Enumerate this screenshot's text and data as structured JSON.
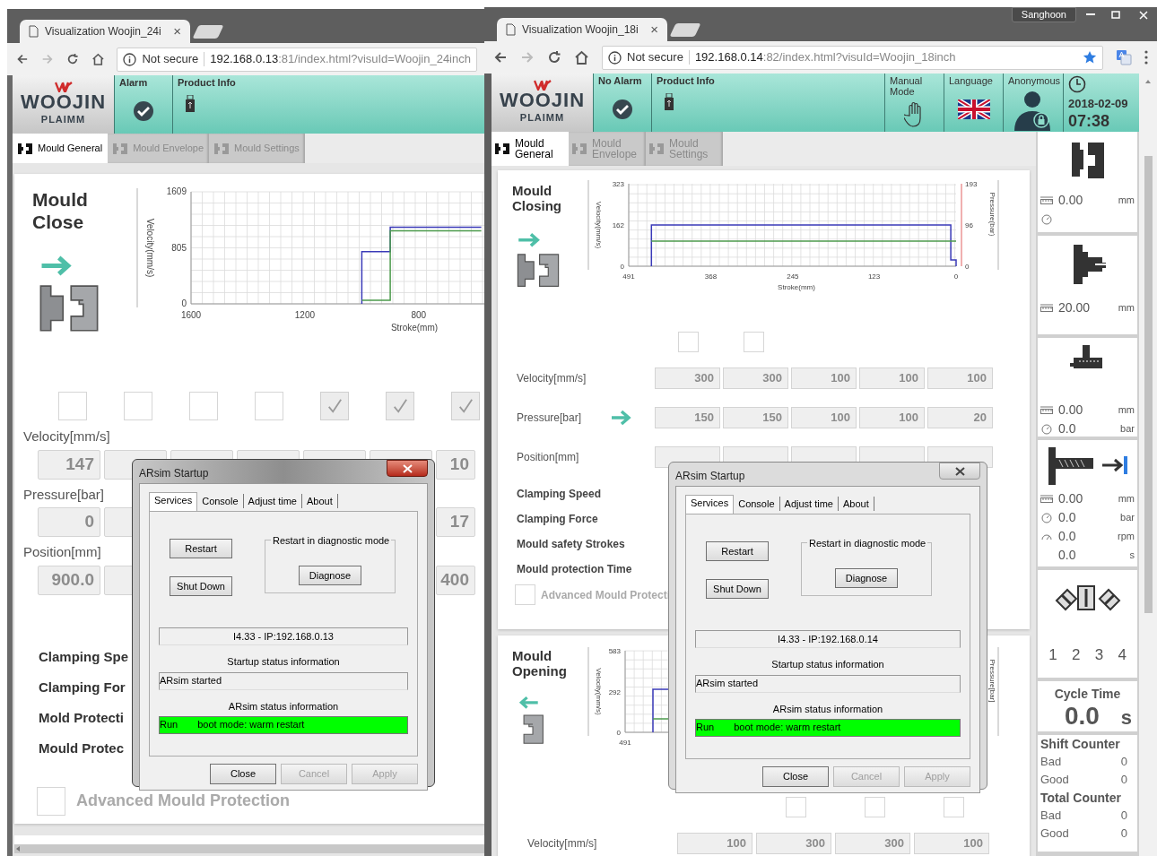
{
  "left_window": {
    "tab": {
      "title": "Visualization Woojin_24i",
      "close": "×"
    },
    "address": {
      "security": "Not secure",
      "host": "192.168.0.13",
      "rest": ":81/index.html?visuId=Woojin_24inch"
    },
    "logo": {
      "name": "WOOJIN",
      "sub": "PLAIMM"
    },
    "header_cells": [
      {
        "kind": "alarm",
        "label": "Alarm"
      },
      {
        "kind": "product",
        "label": "Product Info"
      }
    ],
    "tabs": [
      {
        "label": "Mould General",
        "selected": true
      },
      {
        "label": "Mould Envelope",
        "selected": false
      },
      {
        "label": "Mould Settings",
        "selected": false
      }
    ],
    "section": {
      "title": "Mould Close",
      "chart_data": {
        "type": "line",
        "xlabel": "Stroke(mm)",
        "ylabel": "Velocity(mm/s)",
        "x": [
          1000,
          1000,
          900,
          900,
          580
        ],
        "xlim": [
          1600,
          563
        ],
        "ylim": [
          0,
          1609
        ],
        "xticks": [
          1600,
          1200,
          800
        ],
        "yticks": [
          0,
          805,
          1609
        ],
        "grid": true,
        "series": [
          {
            "color": "#3a3ab8",
            "values": [
              0,
              750,
              750,
              1100,
              1100
            ]
          },
          {
            "color": "#4c9a4c",
            "values": [
              null,
              50,
              50,
              1050,
              1050
            ]
          }
        ]
      },
      "checkboxes": [
        {
          "checked": false
        },
        {
          "checked": false
        },
        {
          "checked": false
        },
        {
          "checked": false
        },
        {
          "checked": true
        },
        {
          "checked": true
        },
        {
          "checked": true
        }
      ],
      "rows": [
        {
          "label": "Velocity[mm/s]",
          "fields": [
            {
              "value": "147"
            },
            {
              "value": "10"
            }
          ]
        },
        {
          "label": "Pressure[bar]",
          "fields": [
            {
              "value": "0"
            },
            {
              "value": "17"
            }
          ]
        },
        {
          "label": "Position[mm]",
          "fields": [
            {
              "value": "900.0"
            },
            {
              "value": "400"
            }
          ]
        }
      ],
      "settings": [
        "Clamping Spe",
        "Clamping For",
        "Mold Protecti",
        "Mould Protec"
      ],
      "advanced": {
        "label": "Advanced Mould Protection",
        "checked": false
      }
    },
    "dialog": {
      "title": "ARsim Startup",
      "active": true,
      "tabs": [
        {
          "label": "Services",
          "selected": true
        },
        {
          "label": "Console",
          "selected": false
        },
        {
          "label": "Adjust time",
          "selected": false
        },
        {
          "label": "About",
          "selected": false
        }
      ],
      "buttons": [
        "Restart",
        "Shut Down"
      ],
      "group": {
        "label": "Restart in diagnostic mode",
        "button": "Diagnose"
      },
      "version": "I4.33 - IP:192.168.0.13",
      "startup_label": "Startup status information",
      "startup_value": "ARsim started",
      "status_label": "ARsim status information",
      "status_state": "Run",
      "status_detail": "boot mode: warm restart",
      "footer_buttons": [
        {
          "label": "Close",
          "disabled": false
        },
        {
          "label": "Cancel",
          "disabled": true
        },
        {
          "label": "Apply",
          "disabled": true
        }
      ]
    }
  },
  "right_window": {
    "profile": "Sanghoon",
    "tab": {
      "title": "Visualization Woojin_18i",
      "close": "×"
    },
    "address": {
      "security": "Not secure",
      "host": "192.168.0.14",
      "rest": ":82/index.html?visuId=Woojin_18inch"
    },
    "logo": {
      "name": "WOOJIN",
      "sub": "PLAIMM"
    },
    "header_cells": [
      {
        "kind": "alarm",
        "label": "No Alarm"
      },
      {
        "kind": "product",
        "label": "Product Info"
      },
      {
        "kind": "manual",
        "label": "Manual Mode"
      },
      {
        "kind": "language",
        "label": "Language"
      },
      {
        "kind": "user",
        "label": "Anonymous"
      },
      {
        "kind": "clock",
        "date": "2018-02-09",
        "time": "07:38"
      }
    ],
    "tabs": [
      {
        "label": "Mould General",
        "selected": true
      },
      {
        "label": "Mould Envelope",
        "selected": false
      },
      {
        "label": "Mould Settings",
        "selected": false
      }
    ],
    "closing": {
      "title": "Mould Closing",
      "chart_data": {
        "type": "line",
        "xlabel": "Stroke(mm)",
        "ylabel": "Velocity(mm/s)",
        "x": [
          457,
          457,
          8,
          8,
          0,
          0
        ],
        "xlim": [
          491,
          0
        ],
        "ylim": [
          0,
          323
        ],
        "xticks": [
          491,
          368,
          245,
          123,
          0
        ],
        "yticks": [
          0,
          162,
          323
        ],
        "grid": true,
        "series": [
          {
            "color": "#3a3ab8",
            "values": [
              0,
              162,
              162,
              25,
              25,
              0
            ]
          },
          {
            "color": "#4c9a4c",
            "values": [
              98,
              98,
              98,
              98,
              98,
              98
            ]
          }
        ]
      },
      "right_axis": {
        "label": "Pressure(bar)",
        "ticks": [
          "193",
          "96",
          "0"
        ]
      },
      "checkboxes": [
        {
          "checked": false
        },
        {
          "checked": false
        }
      ],
      "rows": [
        {
          "label": "Velocity[mm/s]",
          "arrow": false,
          "fields": [
            {
              "value": "300"
            },
            {
              "value": "300"
            },
            {
              "value": "100"
            },
            {
              "value": "100"
            },
            {
              "value": "100"
            }
          ]
        },
        {
          "label": "Pressure[bar]",
          "arrow": true,
          "fields": [
            {
              "value": "150"
            },
            {
              "value": "150"
            },
            {
              "value": "100"
            },
            {
              "value": "100"
            },
            {
              "value": "20"
            }
          ]
        },
        {
          "label": "Position[mm]",
          "arrow": false
        }
      ],
      "settings": [
        "Clamping Speed",
        "Clamping Force",
        "Mould safety Strokes",
        "Mould protection Time"
      ],
      "advanced": {
        "label": "Advanced Mould Protecti",
        "checked": false
      }
    },
    "opening": {
      "title": "Mould Opening",
      "chart": {
        "ylabel": "Velocity(mm/s)",
        "yticks": [
          "583",
          "292",
          "0"
        ],
        "xtick": "491",
        "right_label": "Pressure[bar]"
      },
      "checkboxes": [
        {
          "checked": false
        },
        {
          "checked": false
        },
        {
          "checked": false
        }
      ],
      "rows": [
        {
          "label": "Velocity[mm/s]",
          "fields": [
            {
              "value": "100"
            },
            {
              "value": "300"
            },
            {
              "value": "300"
            },
            {
              "value": "100"
            }
          ]
        }
      ]
    },
    "sidebar": [
      {
        "kind": "clamp",
        "readings": [
          {
            "kind": "stroke",
            "value": "0.00",
            "unit": "mm"
          },
          {
            "kind": "pressure"
          }
        ]
      },
      {
        "kind": "ejector",
        "readings": [
          {
            "kind": "stroke",
            "value": "20.00",
            "unit": "mm"
          }
        ]
      },
      {
        "kind": "nozzle",
        "readings": [
          {
            "kind": "stroke",
            "value": "0.00",
            "unit": "mm"
          },
          {
            "kind": "pressure",
            "value": "0.0",
            "unit": "bar"
          }
        ]
      },
      {
        "kind": "injection",
        "readings": [
          {
            "kind": "stroke",
            "value": "0.00",
            "unit": "mm"
          },
          {
            "kind": "pressure",
            "value": "0.0",
            "unit": "bar"
          },
          {
            "kind": "speed",
            "value": "0.0",
            "unit": "rpm"
          },
          {
            "kind": "time",
            "value": "0.0",
            "unit": "s"
          }
        ]
      },
      {
        "kind": "core",
        "numbers": [
          "1",
          "2",
          "3",
          "4"
        ]
      },
      {
        "kind": "cycle",
        "title": "Cycle Time",
        "value": "0.0",
        "unit": "s"
      },
      {
        "kind": "counters",
        "groups": [
          {
            "title": "Shift Counter",
            "rows": [
              {
                "label": "Bad",
                "value": "0"
              },
              {
                "label": "Good",
                "value": "0"
              }
            ]
          },
          {
            "title": "Total Counter",
            "rows": [
              {
                "label": "Bad",
                "value": "0"
              },
              {
                "label": "Good",
                "value": "0"
              }
            ]
          }
        ]
      }
    ],
    "dialog": {
      "title": "ARsim Startup",
      "active": false,
      "tabs": [
        {
          "label": "Services",
          "selected": true
        },
        {
          "label": "Console",
          "selected": false
        },
        {
          "label": "Adjust time",
          "selected": false
        },
        {
          "label": "About",
          "selected": false
        }
      ],
      "buttons": [
        "Restart",
        "Shut Down"
      ],
      "group": {
        "label": "Restart in diagnostic mode",
        "button": "Diagnose"
      },
      "version": "I4.33 - IP:192.168.0.14",
      "startup_label": "Startup status information",
      "startup_value": "ARsim started",
      "status_label": "ARsim status information",
      "status_state": "Run",
      "status_detail": "boot mode: warm restart",
      "footer_buttons": [
        {
          "label": "Close",
          "disabled": false
        },
        {
          "label": "Cancel",
          "disabled": true
        },
        {
          "label": "Apply",
          "disabled": true
        }
      ]
    }
  }
}
